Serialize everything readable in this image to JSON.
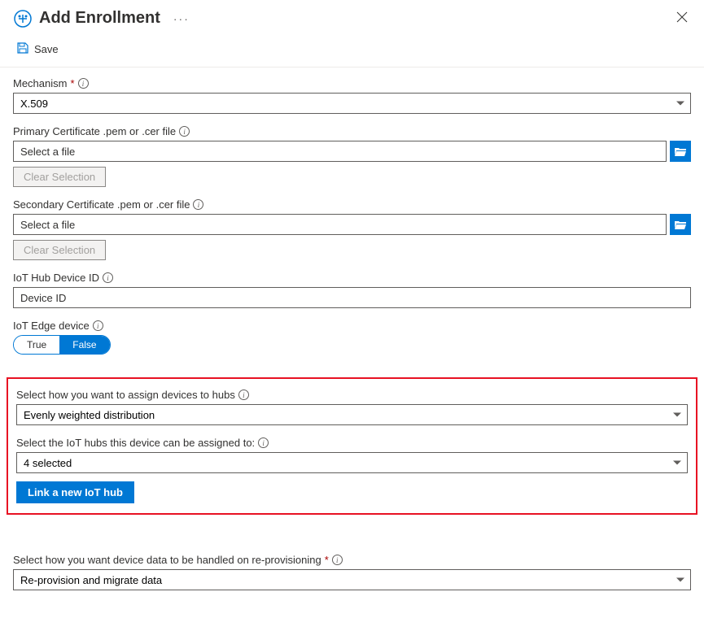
{
  "header": {
    "title": "Add Enrollment"
  },
  "toolbar": {
    "save_label": "Save"
  },
  "mechanism": {
    "label": "Mechanism",
    "value": "X.509"
  },
  "primaryCert": {
    "label": "Primary Certificate .pem or .cer file",
    "placeholder": "Select a file",
    "clear_label": "Clear Selection"
  },
  "secondaryCert": {
    "label": "Secondary Certificate .pem or .cer file",
    "placeholder": "Select a file",
    "clear_label": "Clear Selection"
  },
  "deviceId": {
    "label": "IoT Hub Device ID",
    "placeholder": "Device ID"
  },
  "edgeDevice": {
    "label": "IoT Edge device",
    "true_label": "True",
    "false_label": "False"
  },
  "assignPolicy": {
    "label": "Select how you want to assign devices to hubs",
    "value": "Evenly weighted distribution"
  },
  "hubSelect": {
    "label": "Select the IoT hubs this device can be assigned to:",
    "value": "4 selected"
  },
  "linkHub": {
    "label": "Link a new IoT hub"
  },
  "reprovision": {
    "label": "Select how you want device data to be handled on re-provisioning",
    "value": "Re-provision and migrate data"
  }
}
